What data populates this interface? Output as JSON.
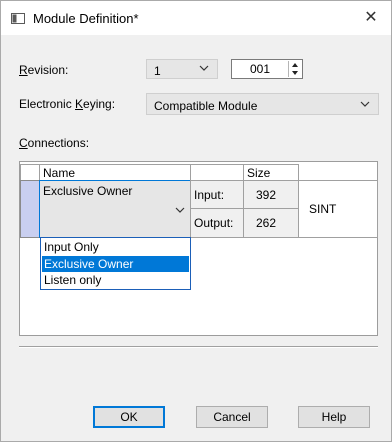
{
  "window": {
    "title": "Module Definition*",
    "close_glyph": "✕"
  },
  "revision": {
    "label_pre": "",
    "label_access": "R",
    "label_post": "evision:",
    "major_value": "1",
    "minor_value": "001"
  },
  "keying": {
    "label_pre": "Electronic ",
    "label_access": "K",
    "label_post": "eying:",
    "value": "Compatible Module"
  },
  "connections": {
    "label_pre": "",
    "label_access": "C",
    "label_post": "onnections:",
    "headers": {
      "name": "Name",
      "size": "Size"
    },
    "row": {
      "name": "Exclusive Owner",
      "input_label": "Input:",
      "input_size": "392",
      "output_label": "Output:",
      "output_size": "262",
      "type": "SINT"
    },
    "dropdown_options": [
      "Input Only",
      "Exclusive Owner",
      "Listen only"
    ],
    "selected_option_index": 1
  },
  "buttons": {
    "ok": "OK",
    "cancel": "Cancel",
    "help": "Help"
  },
  "colors": {
    "accent": "#0078d7",
    "row_selector": "#c9cff0",
    "combo_bg": "#e6e6e6"
  },
  "icons": [
    "module-definition-icon",
    "close-icon",
    "chevron-down-icon",
    "spin-up-icon",
    "spin-down-icon"
  ]
}
